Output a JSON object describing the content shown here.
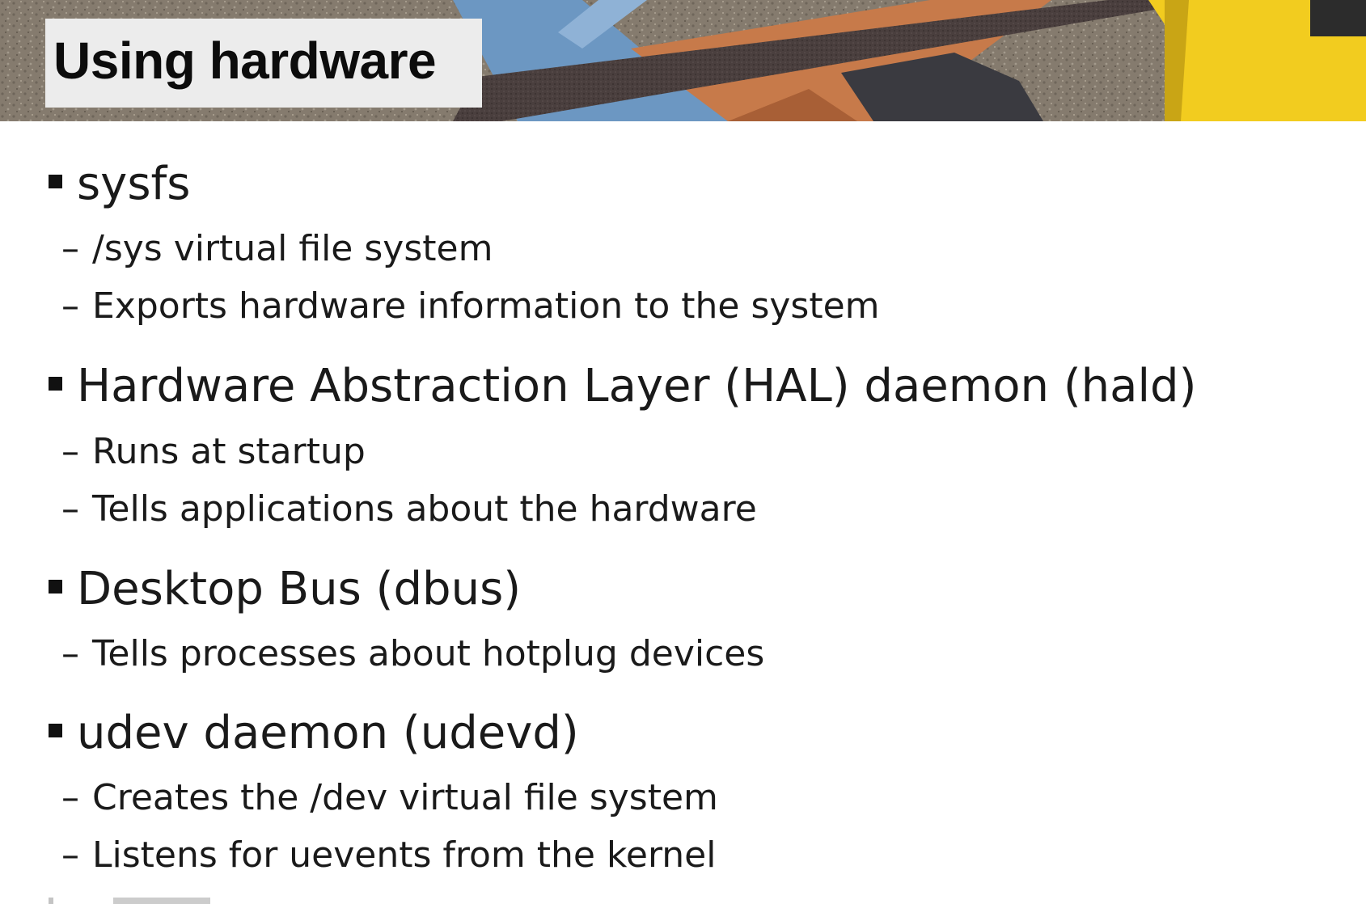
{
  "slide": {
    "title": "Using hardware",
    "sections": [
      {
        "heading": "sysfs",
        "items": [
          "/sys virtual file system",
          "Exports hardware information to the system"
        ]
      },
      {
        "heading": "Hardware Abstraction Layer (HAL) daemon (hald)",
        "items": [
          "Runs at startup",
          "Tells applications about the hardware"
        ]
      },
      {
        "heading": "Desktop Bus (dbus)",
        "items": [
          "Tells processes about hotplug devices"
        ]
      },
      {
        "heading": "udev daemon (udevd)",
        "items": [
          "Creates the /dev virtual file system",
          "Listens for uevents from the kernel"
        ]
      }
    ]
  },
  "icons": {
    "bullet": "square-bullet-icon",
    "sub_bullet": "dash-icon"
  },
  "colors": {
    "title_box": "#ececec",
    "text": "#1a1a1a",
    "accent_yellow": "#f2cc1f"
  }
}
